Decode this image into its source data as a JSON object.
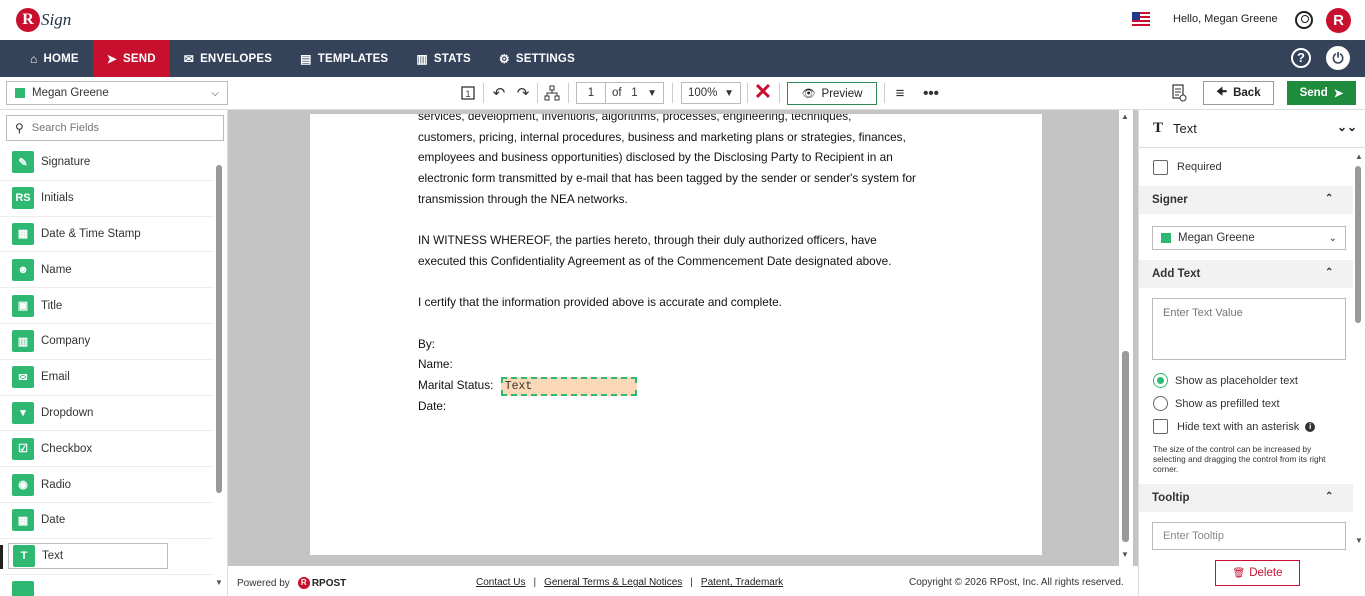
{
  "header": {
    "logo_initial": "R",
    "logo_text": "Sign",
    "greeting": "Hello, Megan Greene",
    "brand_initial": "R"
  },
  "nav": {
    "items": [
      {
        "label": "HOME",
        "icon": "home-icon",
        "glyph": "⌂"
      },
      {
        "label": "SEND",
        "icon": "send-icon",
        "glyph": "➤"
      },
      {
        "label": "ENVELOPES",
        "icon": "envelope-icon",
        "glyph": "✉"
      },
      {
        "label": "TEMPLATES",
        "icon": "document-icon",
        "glyph": "▤"
      },
      {
        "label": "STATS",
        "icon": "stats-icon",
        "glyph": "▥"
      },
      {
        "label": "SETTINGS",
        "icon": "gear-icon",
        "glyph": "⚙"
      }
    ],
    "active": "SEND",
    "help_glyph": "?",
    "power_glyph": "⏻"
  },
  "toolbar": {
    "signer": "Megan Greene",
    "page_current": "1",
    "page_of": "of",
    "page_total": "1",
    "zoom": "100%",
    "preview_label": "Preview",
    "back_label": "Back",
    "send_label": "Send"
  },
  "left_panel": {
    "search_placeholder": "Search Fields",
    "fields": [
      {
        "label": "Signature",
        "icon": "signature-icon",
        "glyph": "✎"
      },
      {
        "label": "Initials",
        "icon": "initials-icon",
        "glyph": "RS"
      },
      {
        "label": "Date & Time Stamp",
        "icon": "calendar-clock-icon",
        "glyph": "▦"
      },
      {
        "label": "Name",
        "icon": "person-icon",
        "glyph": "☻"
      },
      {
        "label": "Title",
        "icon": "briefcase-icon",
        "glyph": "▣"
      },
      {
        "label": "Company",
        "icon": "building-icon",
        "glyph": "▥"
      },
      {
        "label": "Email",
        "icon": "email-icon",
        "glyph": "✉"
      },
      {
        "label": "Dropdown",
        "icon": "dropdown-icon",
        "glyph": "▾"
      },
      {
        "label": "Checkbox",
        "icon": "checkbox-icon",
        "glyph": "☑"
      },
      {
        "label": "Radio",
        "icon": "radio-icon",
        "glyph": "◉"
      },
      {
        "label": "Date",
        "icon": "calendar-icon",
        "glyph": "▦"
      },
      {
        "label": "Text",
        "icon": "text-icon",
        "glyph": "T"
      }
    ],
    "active_field": "Text"
  },
  "document": {
    "para1": [
      "services, development, inventions, algorithms, processes, engineering, techniques,",
      "customers, pricing, internal procedures, business and marketing plans or strategies, finances,",
      "employees and business opportunities) disclosed by the Disclosing Party to Recipient in an",
      "electronic form transmitted by e-mail that has been tagged by the sender or sender's system for",
      "transmission through the NEA networks."
    ],
    "para2": [
      "IN WITNESS WHEREOF, the parties hereto, through their duly authorized officers, have",
      "executed this Confidentiality Agreement as of the Commencement Date designated above."
    ],
    "certify": "I certify that the information provided above is accurate and complete.",
    "by": "By:",
    "name": "Name:",
    "marital": "Marital Status:",
    "text_field": "Text",
    "date": "Date:"
  },
  "footer": {
    "powered_by": "Powered by",
    "rpost": "RPOST",
    "contact": "Contact Us",
    "terms": "General Terms & Legal Notices",
    "patent": "Patent, Trademark",
    "copyright": "Copyright © 2026 RPost, Inc. All rights reserved."
  },
  "right_panel": {
    "title": "Text",
    "required_label": "Required",
    "signer_section": "Signer",
    "signer_value": "Megan Greene",
    "add_text_section": "Add Text",
    "text_placeholder": "Enter Text Value",
    "radio_placeholder": "Show as placeholder text",
    "radio_prefilled": "Show as prefilled text",
    "hide_asterisk": "Hide text with an asterisk",
    "hint": "The size of the control can be increased by selecting and dragging the control from its right corner.",
    "tooltip_section": "Tooltip",
    "tooltip_placeholder": "Enter Tooltip",
    "delete_label": "Delete"
  },
  "colors": {
    "nav_bg": "#34425a",
    "active_red": "#c8102e",
    "field_green": "#2eb872",
    "send_green": "#1e8c3c",
    "text_field_fill": "#fbd9b8"
  }
}
